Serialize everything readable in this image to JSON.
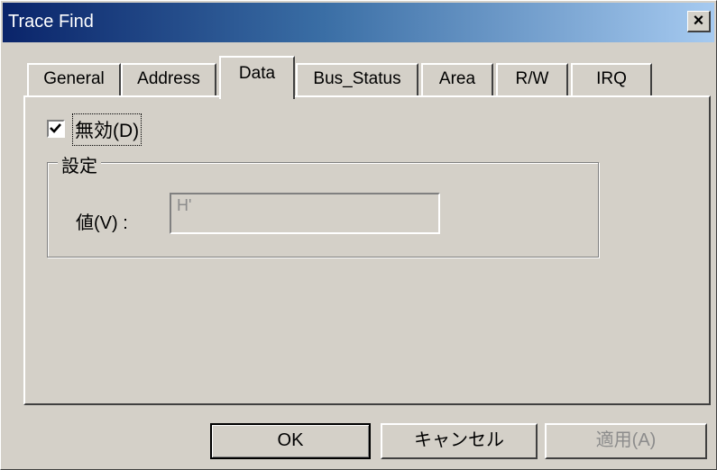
{
  "window": {
    "title": "Trace Find",
    "close_glyph": "×"
  },
  "tabs": [
    {
      "label": "General",
      "active": false
    },
    {
      "label": "Address",
      "active": false
    },
    {
      "label": "Data",
      "active": true
    },
    {
      "label": "Bus_Status",
      "active": false
    },
    {
      "label": "Area",
      "active": false
    },
    {
      "label": "R/W",
      "active": false
    },
    {
      "label": "IRQ",
      "active": false
    }
  ],
  "data_tab": {
    "disable_checkbox": {
      "label": "無効(D)",
      "checked": true
    },
    "settings_group": {
      "title": "設定",
      "value_label": "値(V) :",
      "value_input": "H'"
    }
  },
  "buttons": {
    "ok": "OK",
    "cancel": "キャンセル",
    "apply": "適用(A)"
  },
  "colors": {
    "face": "#d4d0c8",
    "title_start": "#0a246a",
    "title_end": "#a6caf0",
    "disabled_text": "#8c8c8c"
  }
}
